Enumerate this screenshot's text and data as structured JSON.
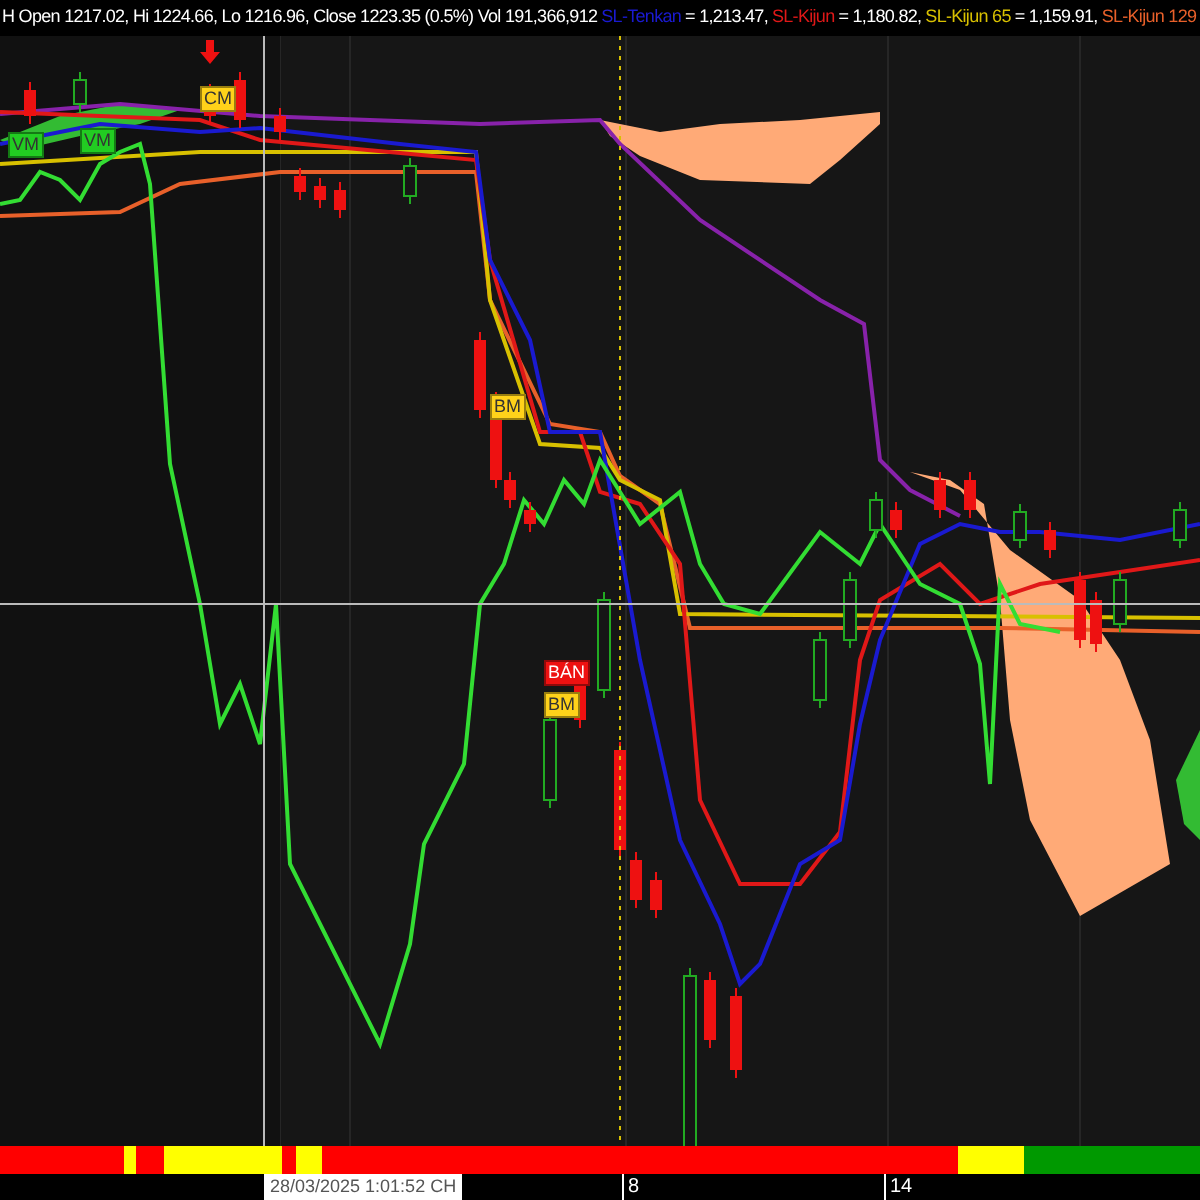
{
  "header": {
    "quote": "H Open 1217.02, Hi 1224.66, Lo 1216.96, Close 1223.35 (0.5%) Vol 191,366,912",
    "indicators": [
      {
        "name": "SL-Tenkan",
        "value": "= 1,213.47,",
        "color": "#1a1ad0"
      },
      {
        "name": "SL-Kijun",
        "value": "= 1,180.82,",
        "color": "#e01818"
      },
      {
        "name": "SL-Kijun 65",
        "value": "= 1,159.91,",
        "color": "#d8c000"
      },
      {
        "name": "SL-Kijun 129",
        "color": "#e8602a"
      }
    ]
  },
  "signals": [
    {
      "label": "VM",
      "color": "#22cc22"
    },
    {
      "label": "VM",
      "color": "#22cc22"
    },
    {
      "label": "CM",
      "color": "#ffd21a"
    },
    {
      "label": "BM",
      "color": "#ffd21a"
    },
    {
      "label": "BÁN",
      "color": "#ee1111"
    },
    {
      "label": "BM",
      "color": "#ffd21a"
    }
  ],
  "trend_strip": [
    {
      "color": "#ff0000"
    },
    {
      "color": "#ffff00"
    },
    {
      "color": "#ff0000"
    },
    {
      "color": "#ffff00"
    },
    {
      "color": "#ff0000"
    },
    {
      "color": "#ffff00"
    },
    {
      "color": "#ff0000"
    },
    {
      "color": "#ffff00"
    },
    {
      "color": "#009900"
    }
  ],
  "x_axis": {
    "labels": [
      "8",
      "14"
    ],
    "cursor_time": "28/03/2025 1:01:52 CH"
  }
}
